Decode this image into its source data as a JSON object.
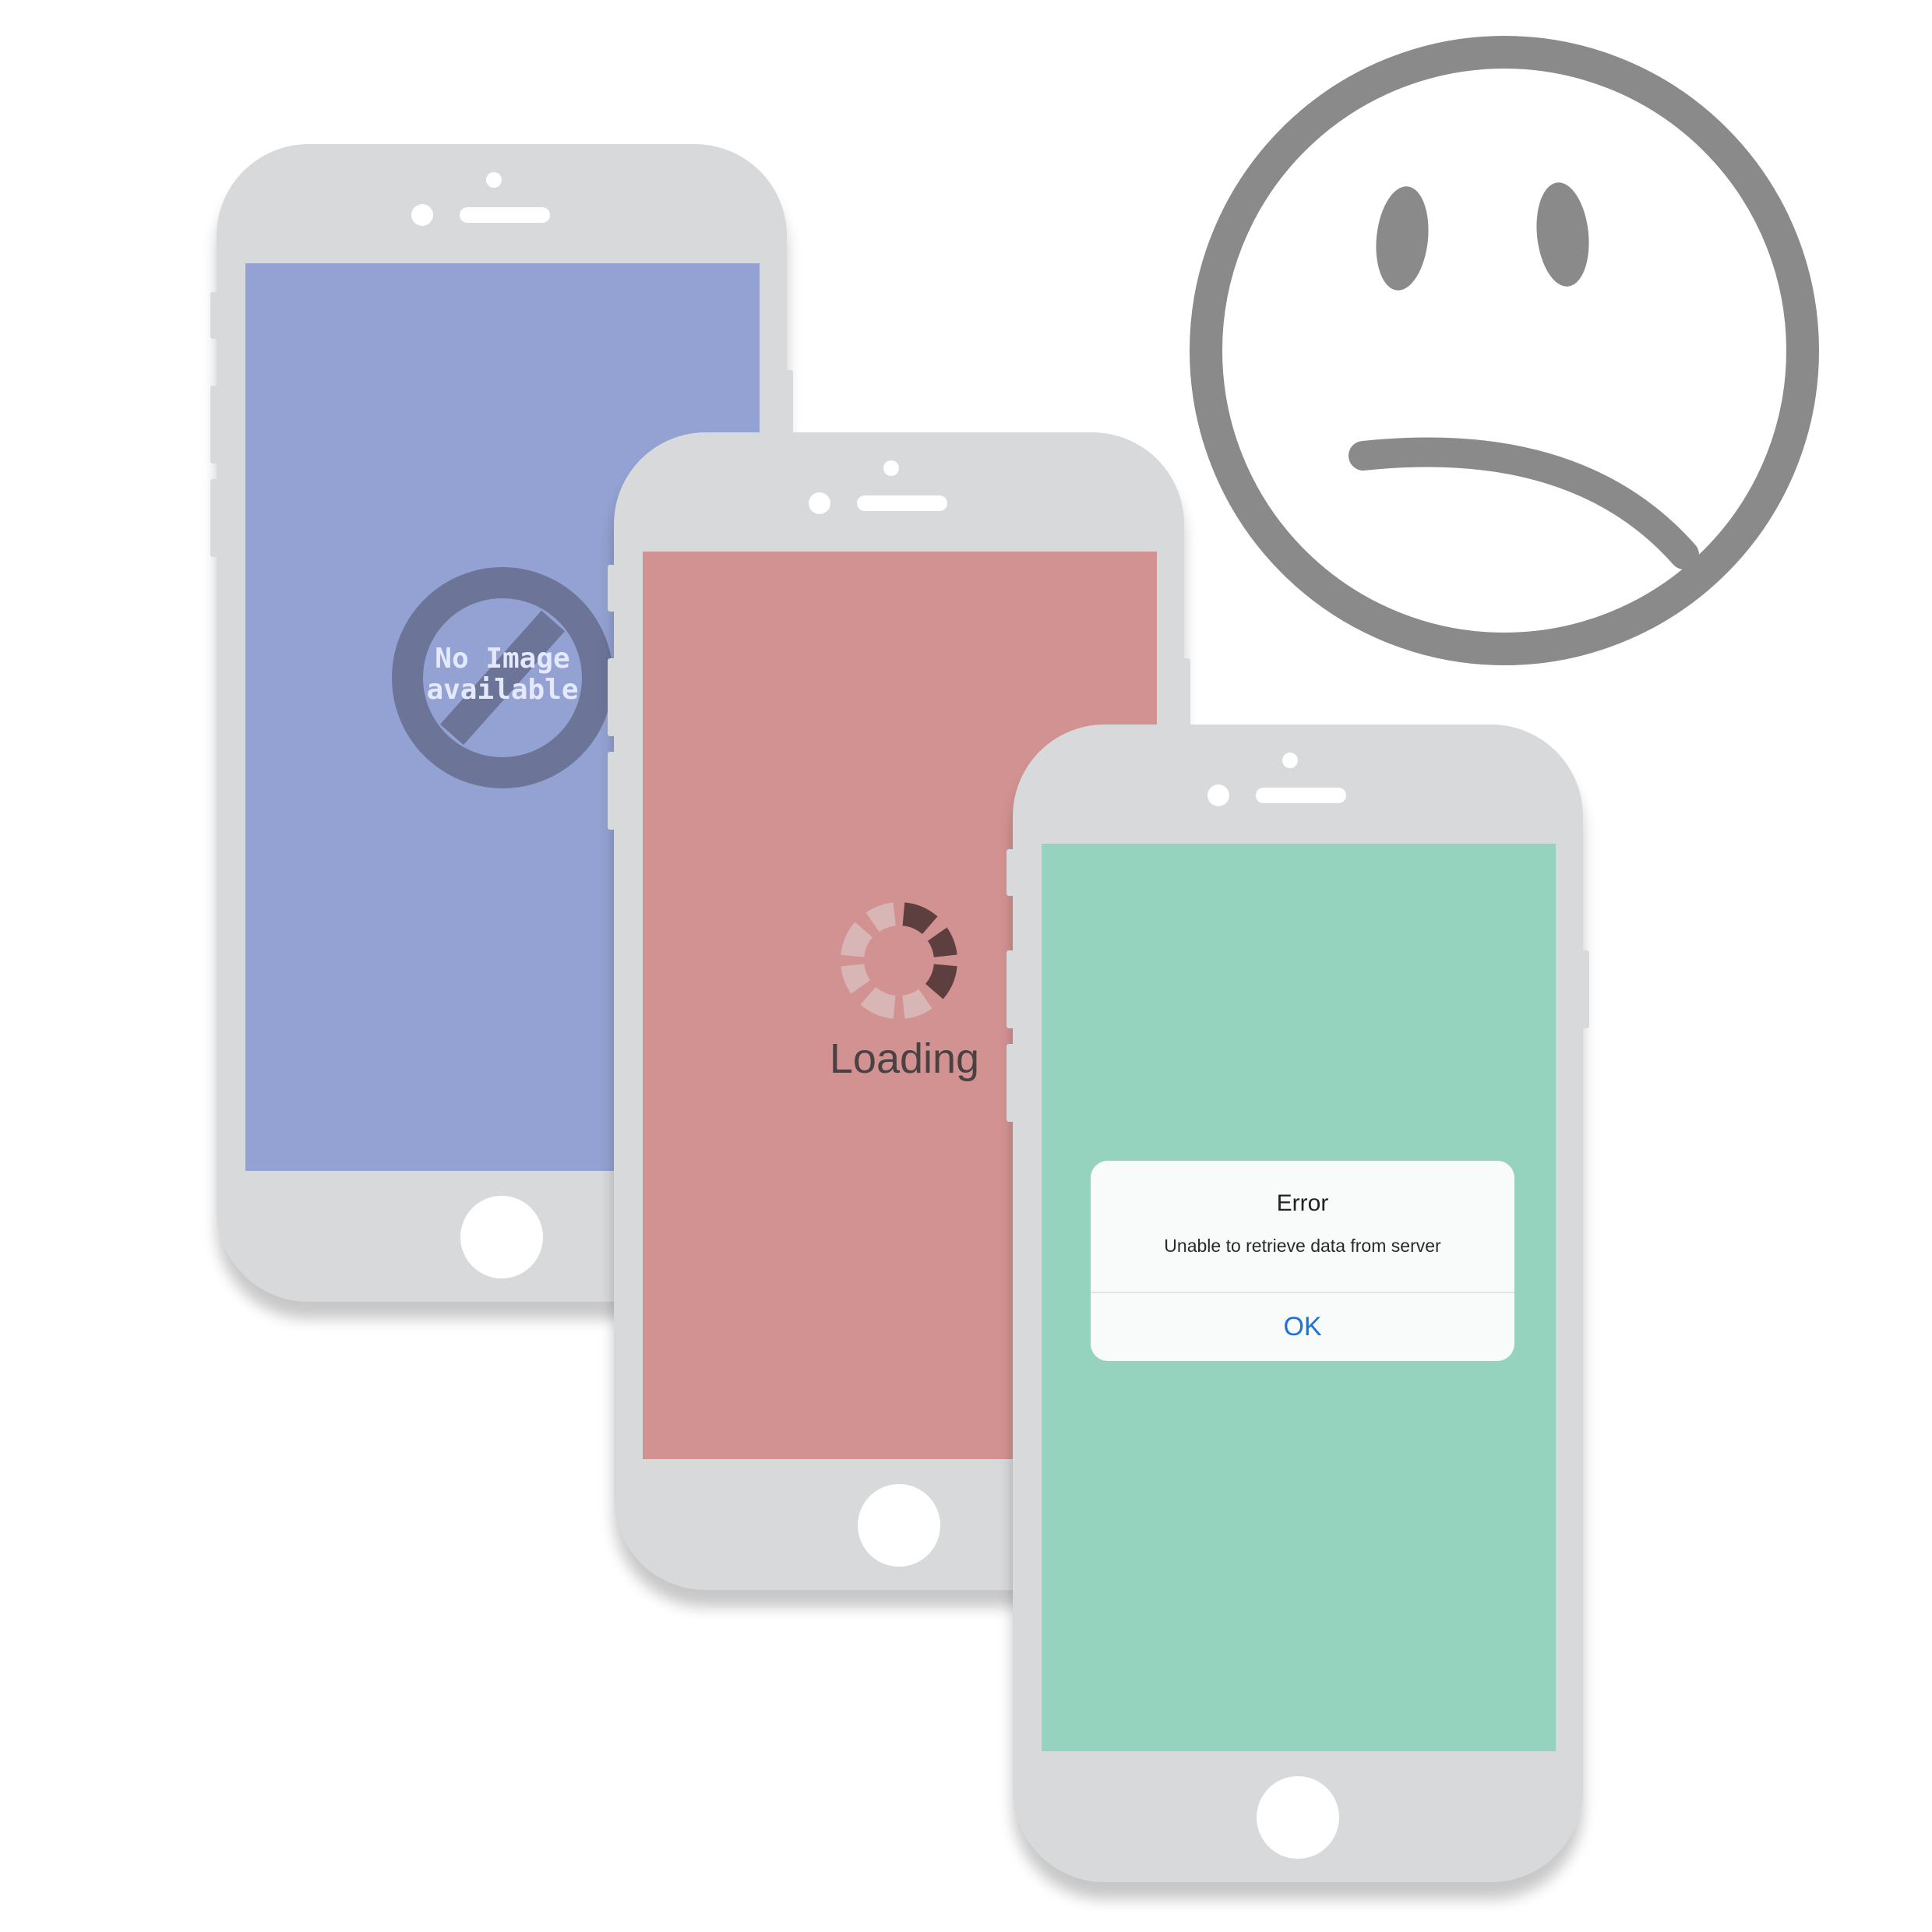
{
  "phones": {
    "no_image": {
      "screen_color": "#93a2d2",
      "placeholder_lines": [
        "No Image",
        "available"
      ]
    },
    "loading": {
      "screen_color": "#d39292",
      "label": "Loading",
      "spinner_icon": "loading-spinner-icon"
    },
    "error": {
      "screen_color": "#95d3be",
      "dialog": {
        "title": "Error",
        "message": "Unable to retrieve data from server",
        "ok_label": "OK"
      }
    }
  },
  "decoration": {
    "icon": "sad-face-icon",
    "color": "#8a8a8a"
  },
  "colors": {
    "phone_body": "#d8d9db",
    "dialog_accent": "#1a73d9"
  }
}
